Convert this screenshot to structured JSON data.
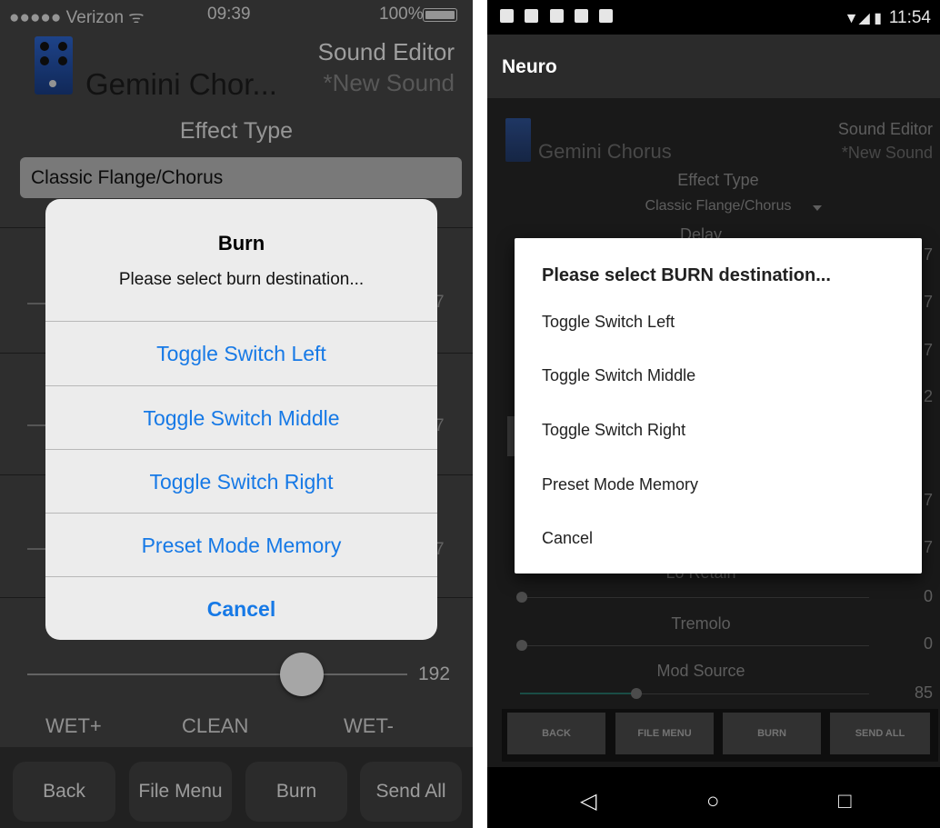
{
  "ios": {
    "status": {
      "carrier": "●●●●● Verizon ᯤ",
      "time": "09:39",
      "battery": "100%"
    },
    "header": {
      "product": "Gemini Chor...",
      "title": "Sound Editor",
      "subtitle": "*New Sound"
    },
    "effect_type_label": "Effect Type",
    "effect_type_value": "Classic Flange/Chorus",
    "background_values": [
      "7",
      "7",
      "7"
    ],
    "slider": {
      "value": "192",
      "position_fraction": 0.72
    },
    "mix_labels": [
      "WET+",
      "CLEAN",
      "WET-"
    ],
    "toolbar": [
      "Back",
      "File Menu",
      "Burn",
      "Send All"
    ],
    "alert": {
      "title": "Burn",
      "message": "Please select burn destination...",
      "options": [
        "Toggle Switch Left",
        "Toggle Switch Middle",
        "Toggle Switch Right",
        "Preset Mode Memory"
      ],
      "cancel": "Cancel"
    }
  },
  "android": {
    "app_title": "Neuro",
    "status_time": "11:54",
    "header": {
      "product": "Gemini Chorus",
      "title": "Sound Editor",
      "subtitle": "*New Sound"
    },
    "effect_type_label": "Effect Type",
    "effect_type_value": "Classic Flange/Chorus",
    "background_rows": [
      {
        "label": "Delay",
        "value": "7"
      },
      {
        "label": "",
        "value": "7"
      },
      {
        "label": "",
        "value": "7"
      },
      {
        "label": "",
        "value": "2"
      },
      {
        "label": "",
        "value": "7"
      },
      {
        "label": "",
        "value": "7"
      },
      {
        "label": "Lo Retain",
        "value": "0"
      },
      {
        "label": "Tremolo",
        "value": "0"
      },
      {
        "label": "Mod Source",
        "value": "85"
      }
    ],
    "toolbar": [
      "BACK",
      "FILE MENU",
      "BURN",
      "SEND ALL"
    ],
    "dialog": {
      "title": "Please select BURN destination...",
      "options": [
        "Toggle Switch Left",
        "Toggle Switch Middle",
        "Toggle Switch Right",
        "Preset Mode Memory",
        "Cancel"
      ]
    },
    "colors": {
      "accent": "#1679e6",
      "dialog_bg": "#ffffff"
    }
  }
}
